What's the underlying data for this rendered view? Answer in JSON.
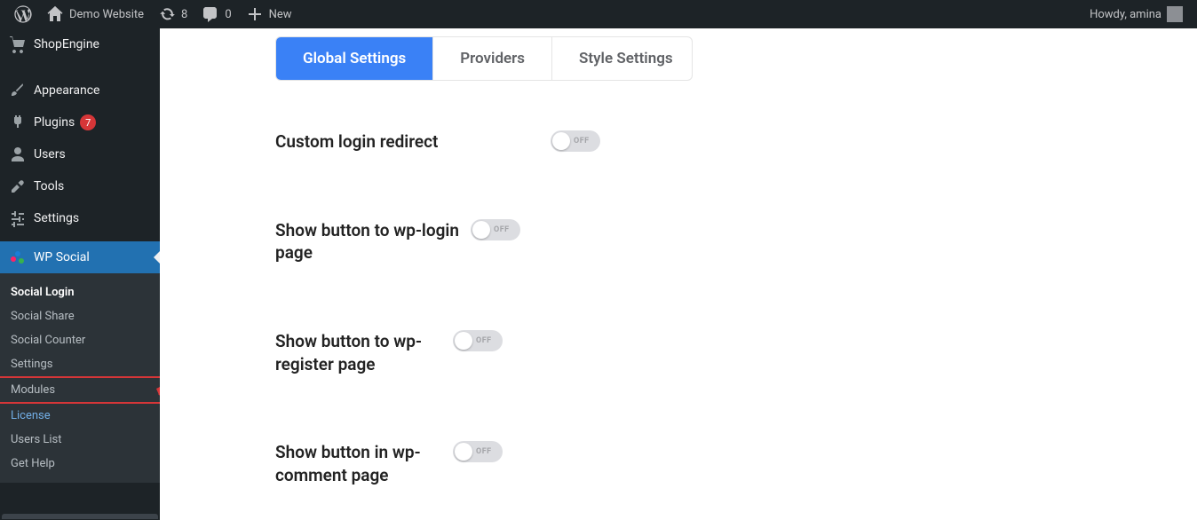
{
  "adminbar": {
    "site_name": "Demo Website",
    "updates": "8",
    "comments": "0",
    "new": "New",
    "greeting": "Howdy, amina"
  },
  "sidebar": {
    "items": [
      {
        "label": "ShopEngine"
      },
      {
        "label": "Appearance"
      },
      {
        "label": "Plugins",
        "badge": "7"
      },
      {
        "label": "Users"
      },
      {
        "label": "Tools"
      },
      {
        "label": "Settings"
      },
      {
        "label": "WP Social"
      }
    ],
    "submenu": [
      {
        "label": "Social Login"
      },
      {
        "label": "Social Share"
      },
      {
        "label": "Social Counter"
      },
      {
        "label": "Settings"
      },
      {
        "label": "Modules"
      },
      {
        "label": "License"
      },
      {
        "label": "Users List"
      },
      {
        "label": "Get Help"
      }
    ]
  },
  "tabs": [
    {
      "label": "Global Settings"
    },
    {
      "label": "Providers"
    },
    {
      "label": "Style Settings"
    }
  ],
  "settings": [
    {
      "label": "Custom login redirect",
      "state": "OFF"
    },
    {
      "label": "Show button to wp-login page",
      "state": "OFF"
    },
    {
      "label": "Show button to wp-register page",
      "state": "OFF"
    },
    {
      "label": "Show button in wp-comment page",
      "state": "OFF"
    }
  ]
}
